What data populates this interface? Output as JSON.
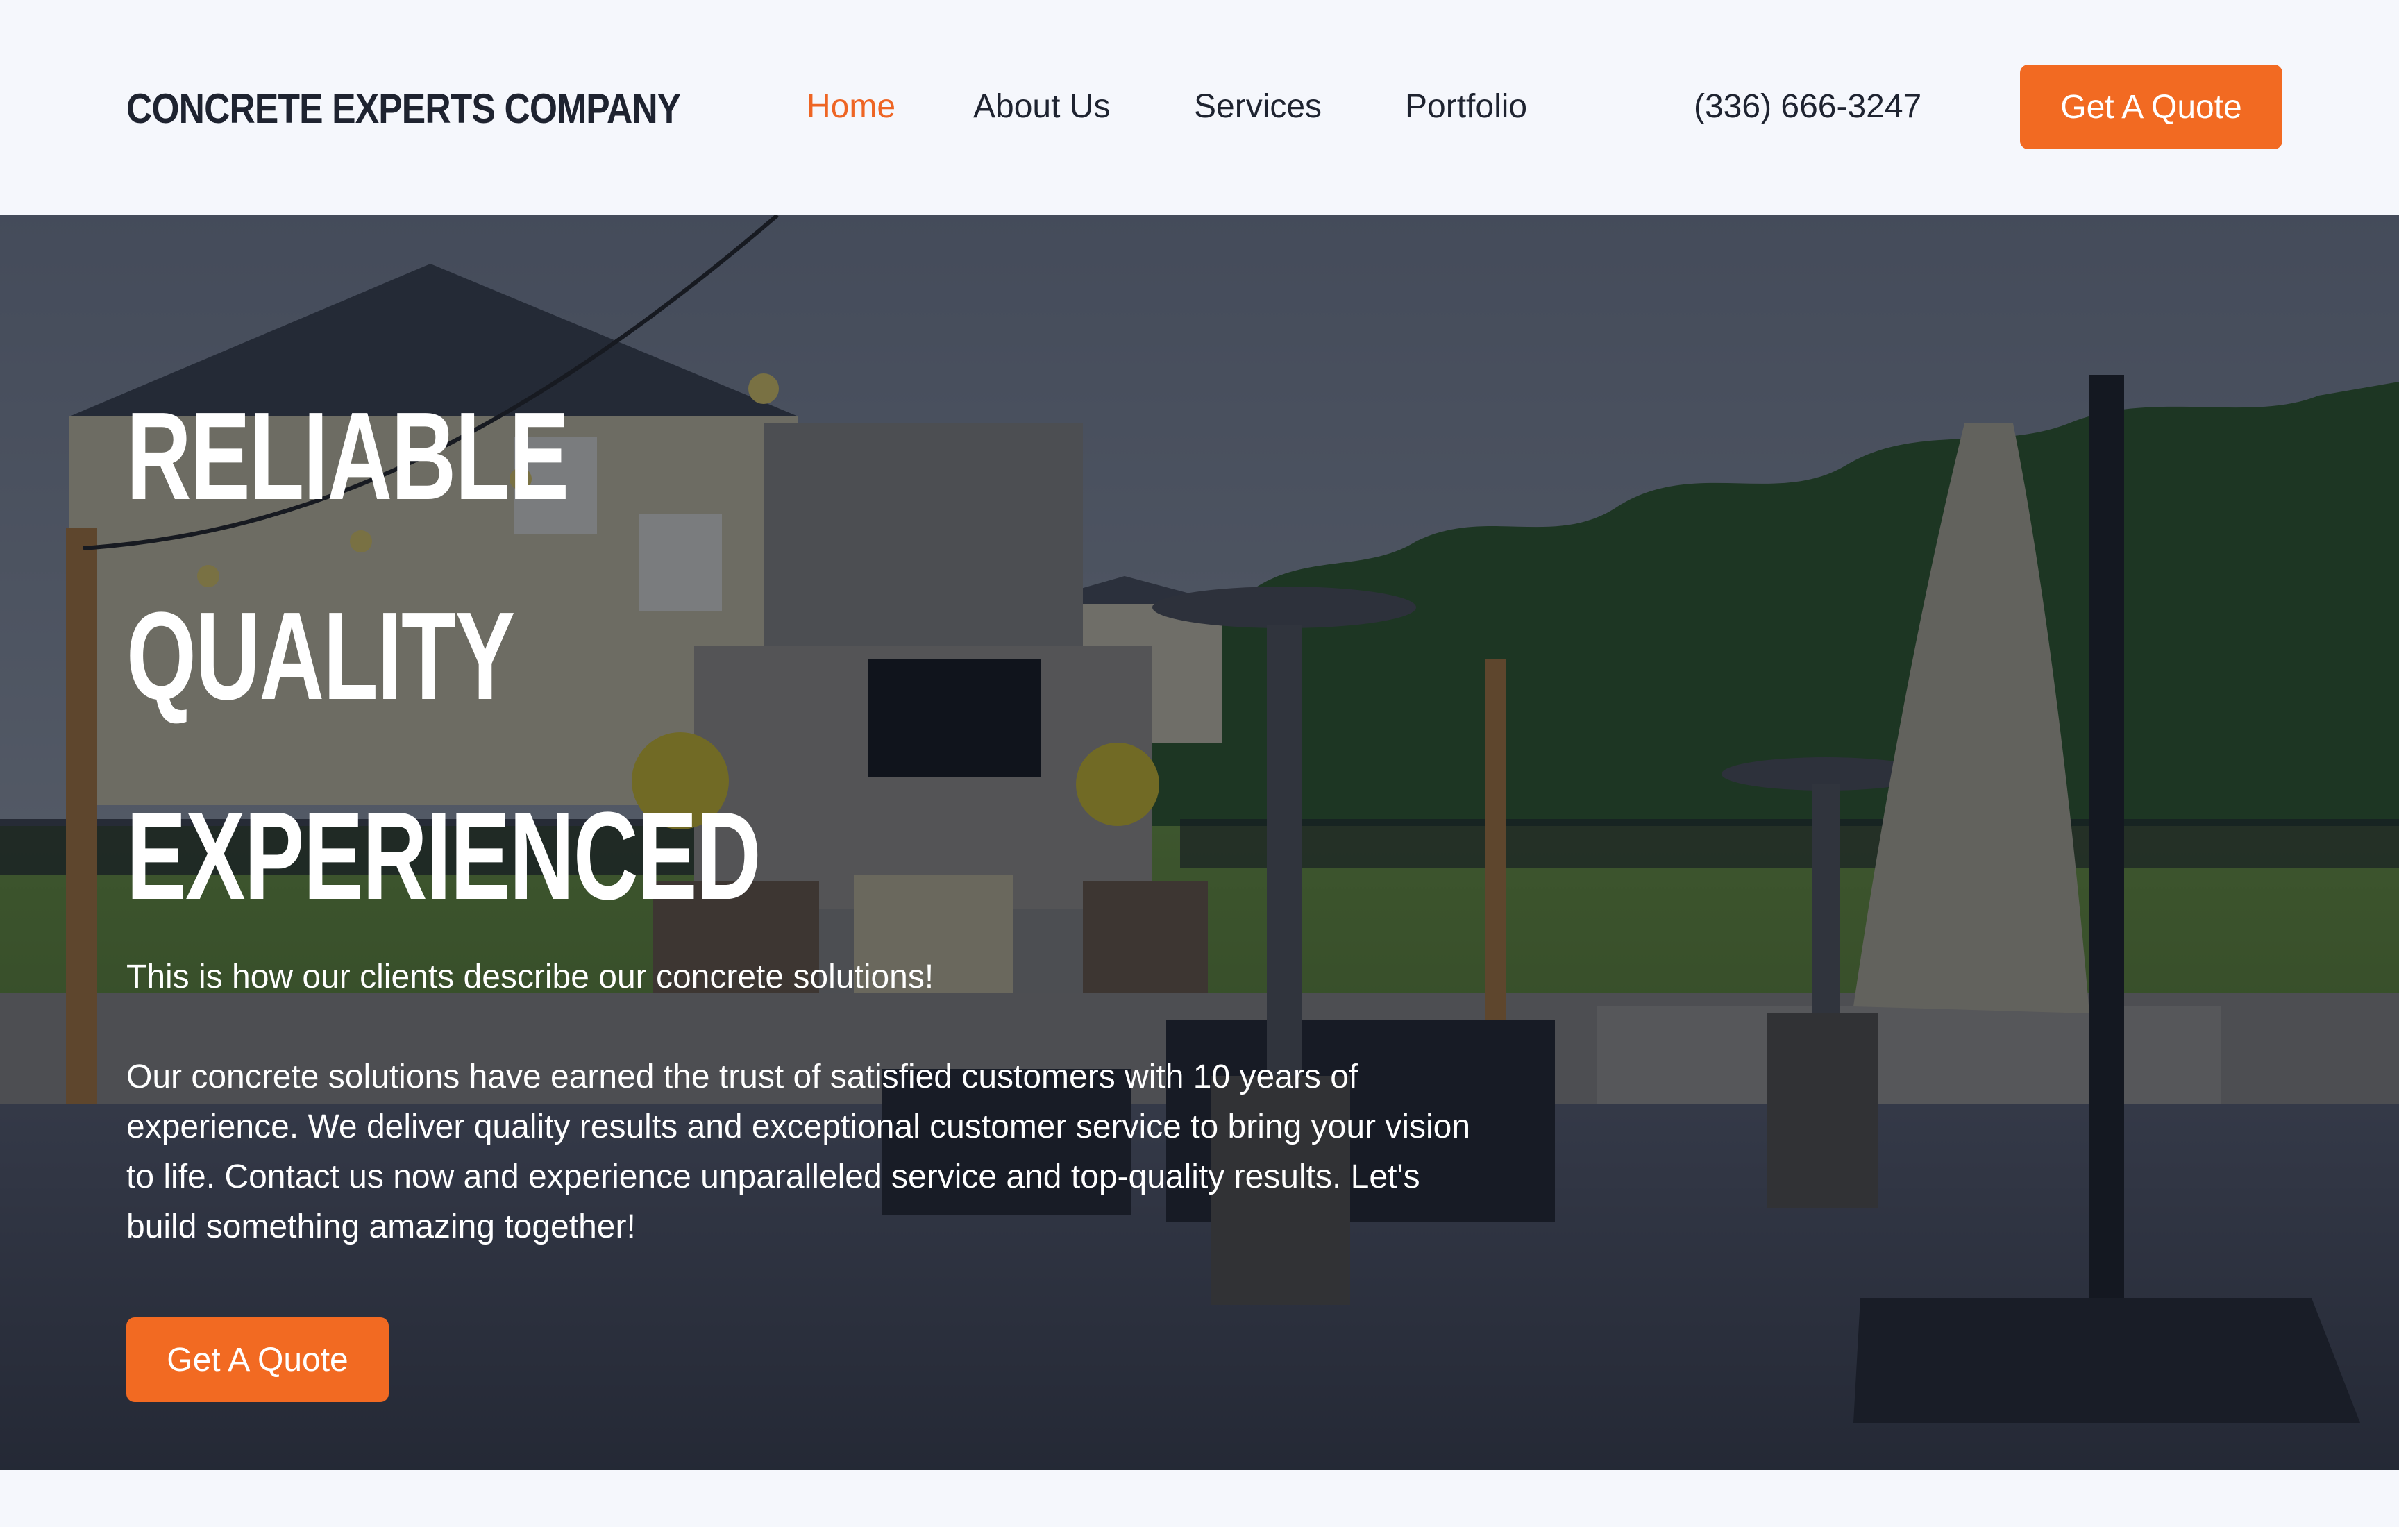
{
  "header": {
    "logo": "CONCRETE EXPERTS COMPANY",
    "nav": [
      {
        "label": "Home",
        "active": true
      },
      {
        "label": "About Us",
        "active": false
      },
      {
        "label": "Services",
        "active": false
      },
      {
        "label": "Portfolio",
        "active": false
      }
    ],
    "phone": "(336) 666-3247",
    "cta": "Get A Quote"
  },
  "hero": {
    "headline": [
      "RELIABLE",
      "QUALITY",
      "EXPERIENCED"
    ],
    "subtitle": "This is how our clients describe our concrete solutions!",
    "paragraph": "Our concrete solutions have earned the trust of satisfied customers with 10 years of experience. We deliver quality results and exceptional customer service to bring your vision to life. Contact us now and experience unparalleled service and top-quality results. Let's build something amazing together!",
    "cta": "Get A Quote"
  },
  "colors": {
    "accent": "#f26a22",
    "nav_active": "#ee6524",
    "text_dark": "#1e2330",
    "background": "#f5f7fc"
  }
}
